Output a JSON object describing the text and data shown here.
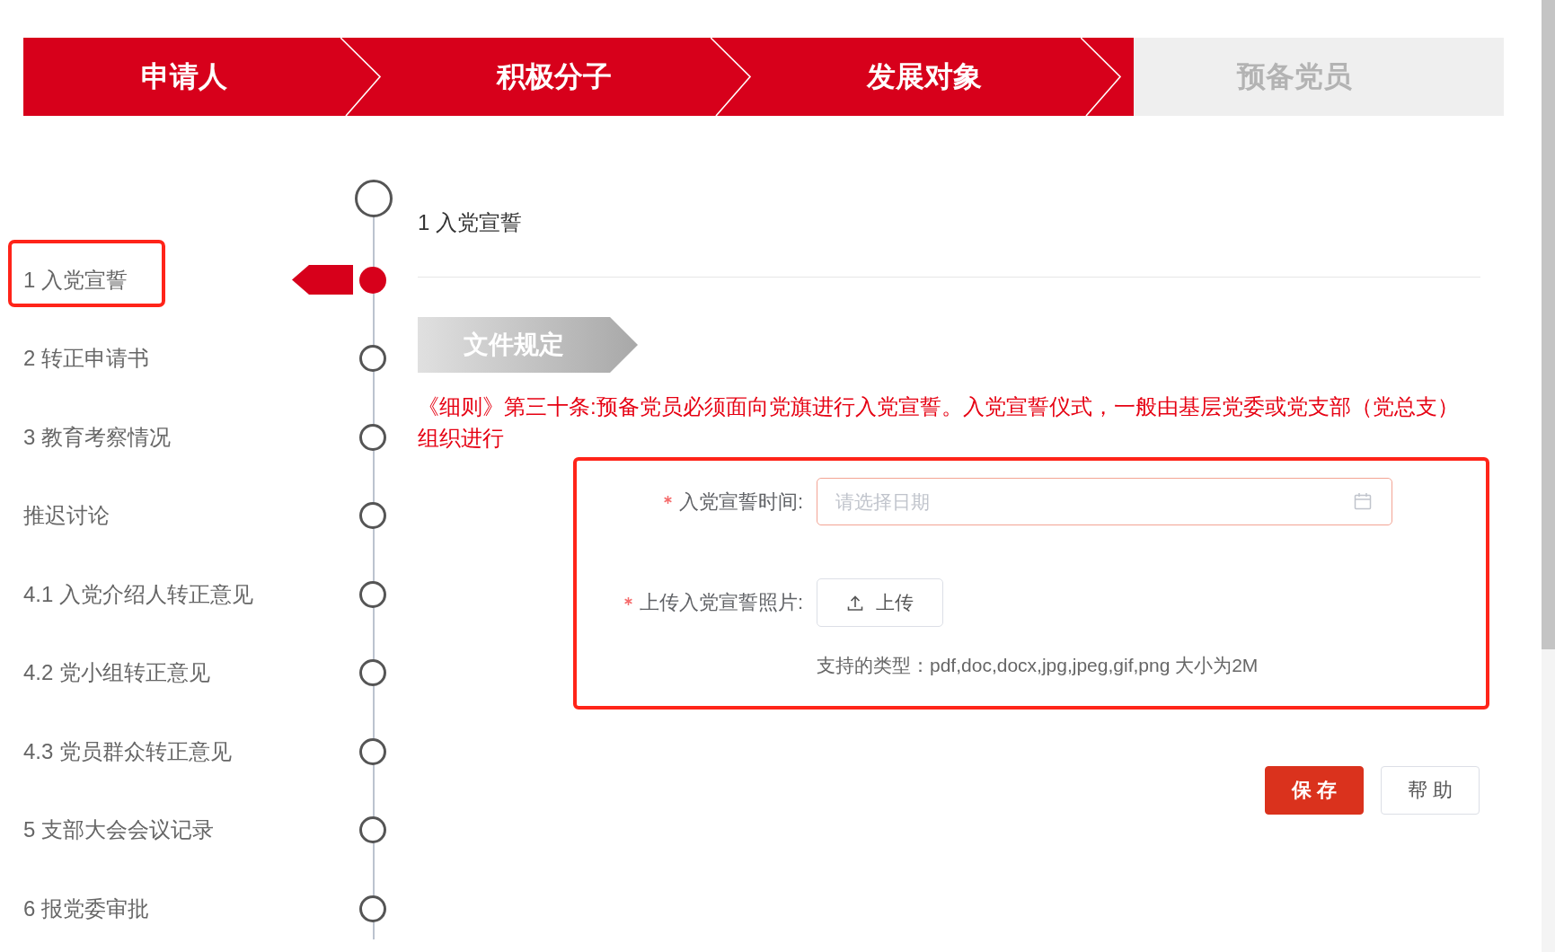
{
  "steps": [
    {
      "label": "申请人",
      "reached": true
    },
    {
      "label": "积极分子",
      "reached": true
    },
    {
      "label": "发展对象",
      "reached": true
    },
    {
      "label": "预备党员",
      "reached": false
    }
  ],
  "timeline": {
    "items": [
      {
        "label": "1 入党宣誓",
        "selected": true,
        "highlighted": true
      },
      {
        "label": "2 转正申请书",
        "selected": false,
        "highlighted": false
      },
      {
        "label": "3 教育考察情况",
        "selected": false,
        "highlighted": false
      },
      {
        "label": "推迟讨论",
        "selected": false,
        "highlighted": false
      },
      {
        "label": "4.1 入党介绍人转正意见",
        "selected": false,
        "highlighted": false
      },
      {
        "label": "4.2 党小组转正意见",
        "selected": false,
        "highlighted": false
      },
      {
        "label": "4.3 党员群众转正意见",
        "selected": false,
        "highlighted": false
      },
      {
        "label": "5 支部大会会议记录",
        "selected": false,
        "highlighted": false
      },
      {
        "label": "6 报党委审批",
        "selected": false,
        "highlighted": false
      }
    ]
  },
  "section": {
    "title": "1 入党宣誓",
    "tag": "文件规定",
    "rule_text": "《细则》第三十条:预备党员必须面向党旗进行入党宣誓。入党宣誓仪式，一般由基层党委或党支部（党总支）组织进行",
    "form": {
      "highlighted": true,
      "fields": [
        {
          "kind": "date",
          "label": "入党宣誓时间:",
          "required": true,
          "placeholder": "请选择日期"
        },
        {
          "kind": "upload",
          "label": "上传入党宣誓照片:",
          "required": true,
          "button_label": "上传"
        }
      ],
      "hint": "支持的类型：pdf,doc,docx,jpg,jpeg,gif,png 大小为2M"
    },
    "buttons": [
      {
        "kind": "primary",
        "label": "保 存"
      },
      {
        "kind": "plain",
        "label": "帮 助"
      }
    ]
  }
}
